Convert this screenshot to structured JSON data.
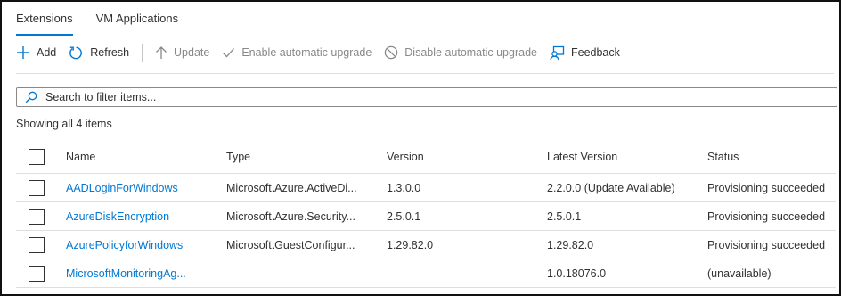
{
  "tabs": [
    {
      "label": "Extensions",
      "active": true
    },
    {
      "label": "VM Applications",
      "active": false
    }
  ],
  "toolbar": {
    "add": "Add",
    "refresh": "Refresh",
    "update": "Update",
    "enable_auto": "Enable automatic upgrade",
    "disable_auto": "Disable automatic upgrade",
    "feedback": "Feedback"
  },
  "search": {
    "placeholder": "Search to filter items..."
  },
  "count_text": "Showing all 4 items",
  "columns": {
    "name": "Name",
    "type": "Type",
    "version": "Version",
    "latest": "Latest Version",
    "status": "Status"
  },
  "rows": [
    {
      "name": "AADLoginForWindows",
      "type": "Microsoft.Azure.ActiveDi...",
      "version": "1.3.0.0",
      "latest": "2.2.0.0 (Update Available)",
      "status": "Provisioning succeeded"
    },
    {
      "name": "AzureDiskEncryption",
      "type": "Microsoft.Azure.Security...",
      "version": "2.5.0.1",
      "latest": "2.5.0.1",
      "status": "Provisioning succeeded"
    },
    {
      "name": "AzurePolicyforWindows",
      "type": "Microsoft.GuestConfigur...",
      "version": "1.29.82.0",
      "latest": "1.29.82.0",
      "status": "Provisioning succeeded"
    },
    {
      "name": "MicrosoftMonitoringAg...",
      "type": "",
      "version": "",
      "latest": "1.0.18076.0",
      "status": "(unavailable)"
    }
  ],
  "colors": {
    "accent": "#0078d4",
    "disabled": "#8a8886",
    "text": "#323130"
  },
  "icons": [
    "add-icon",
    "refresh-icon",
    "arrow-up-icon",
    "checkmark-icon",
    "circle-slash-icon",
    "feedback-icon",
    "search-icon"
  ]
}
